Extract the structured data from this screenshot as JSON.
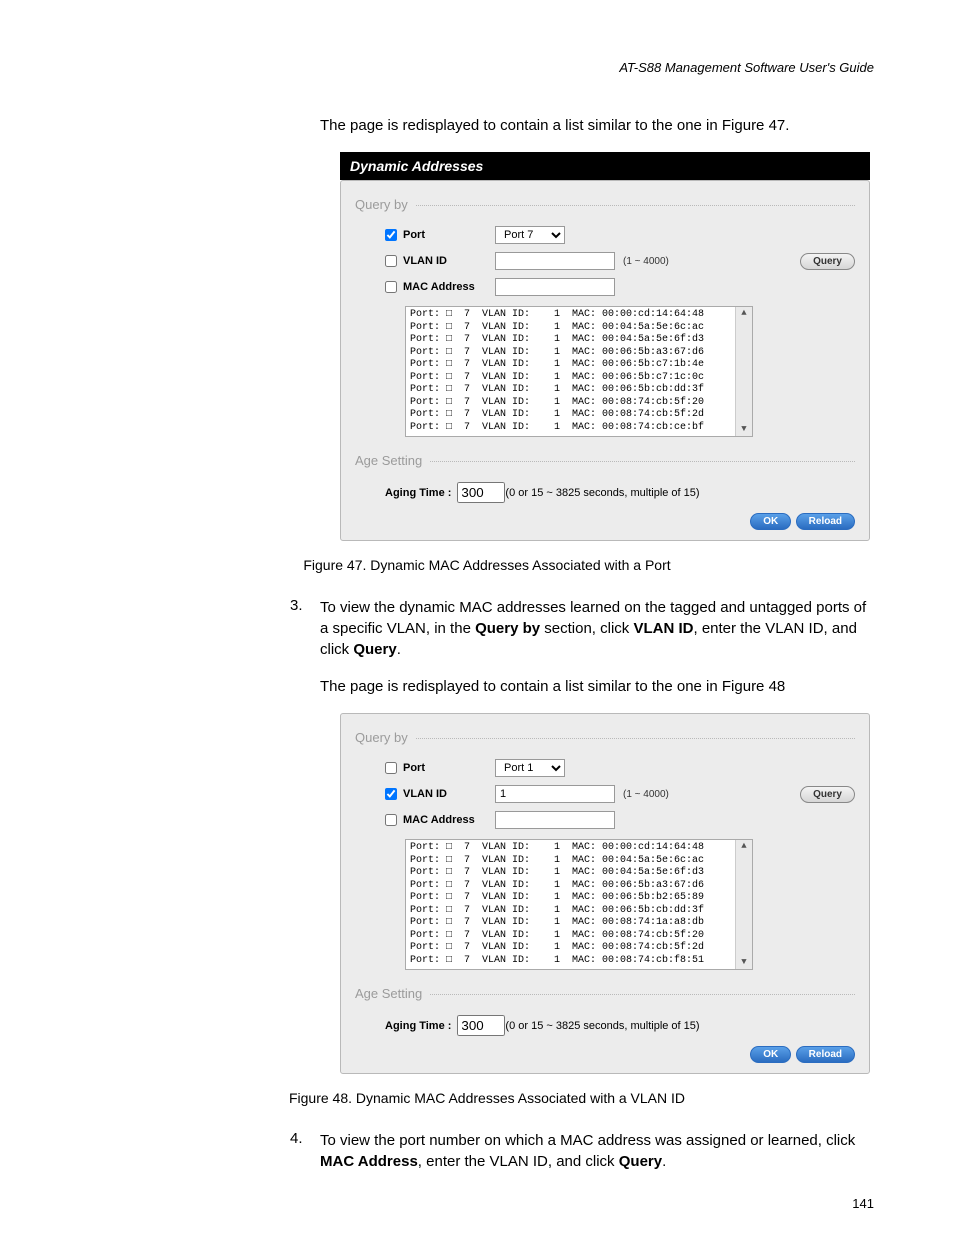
{
  "header": {
    "title": "AT-S88 Management Software User's Guide"
  },
  "intro1": "The page is redisplayed to contain a list similar to the one in Figure 47.",
  "fig47": {
    "header": "Dynamic Addresses",
    "query_section": "Query by",
    "age_section": "Age Setting",
    "port_label": "Port",
    "port_checked": true,
    "port_select": "Port 7",
    "vlan_label": "VLAN ID",
    "vlan_checked": false,
    "vlan_value": "",
    "vlan_range": "(1 ~ 4000)",
    "mac_label": "MAC Address",
    "mac_checked": false,
    "mac_value": "",
    "query_btn": "Query",
    "lines": "Port: □  7  VLAN ID:    1  MAC: 00:00:cd:14:64:48\nPort: □  7  VLAN ID:    1  MAC: 00:04:5a:5e:6c:ac\nPort: □  7  VLAN ID:    1  MAC: 00:04:5a:5e:6f:d3\nPort: □  7  VLAN ID:    1  MAC: 00:06:5b:a3:67:d6\nPort: □  7  VLAN ID:    1  MAC: 00:06:5b:c7:1b:4e\nPort: □  7  VLAN ID:    1  MAC: 00:06:5b:c7:1c:0c\nPort: □  7  VLAN ID:    1  MAC: 00:06:5b:cb:dd:3f\nPort: □  7  VLAN ID:    1  MAC: 00:08:74:cb:5f:20\nPort: □  7  VLAN ID:    1  MAC: 00:08:74:cb:5f:2d\nPort: □  7  VLAN ID:    1  MAC: 00:08:74:cb:ce:bf",
    "aging_label": "Aging Time :",
    "aging_value": "300",
    "aging_range": "(0 or 15 ~ 3825 seconds, multiple of 15)",
    "ok_btn": "OK",
    "reload_btn": "Reload",
    "caption": "Figure 47. Dynamic MAC Addresses Associated with a Port"
  },
  "step3": {
    "num": "3.",
    "text_parts": [
      "To view the dynamic MAC addresses learned on the tagged and untagged ports of a specific VLAN, in the ",
      "Query by",
      " section, click ",
      "VLAN ID",
      ", enter the VLAN ID, and click ",
      "Query",
      "."
    ]
  },
  "intro2": "The page is redisplayed to contain a list similar to the one in Figure 48",
  "fig48": {
    "query_section": "Query by",
    "age_section": "Age Setting",
    "port_label": "Port",
    "port_checked": false,
    "port_select": "Port 1",
    "vlan_label": "VLAN ID",
    "vlan_checked": true,
    "vlan_value": "1",
    "vlan_range": "(1 ~ 4000)",
    "mac_label": "MAC Address",
    "mac_checked": false,
    "mac_value": "",
    "query_btn": "Query",
    "lines": "Port: □  7  VLAN ID:    1  MAC: 00:00:cd:14:64:48\nPort: □  7  VLAN ID:    1  MAC: 00:04:5a:5e:6c:ac\nPort: □  7  VLAN ID:    1  MAC: 00:04:5a:5e:6f:d3\nPort: □  7  VLAN ID:    1  MAC: 00:06:5b:a3:67:d6\nPort: □  7  VLAN ID:    1  MAC: 00:06:5b:b2:65:89\nPort: □  7  VLAN ID:    1  MAC: 00:06:5b:cb:dd:3f\nPort: □  7  VLAN ID:    1  MAC: 00:08:74:1a:a8:db\nPort: □  7  VLAN ID:    1  MAC: 00:08:74:cb:5f:20\nPort: □  7  VLAN ID:    1  MAC: 00:08:74:cb:5f:2d\nPort: □  7  VLAN ID:    1  MAC: 00:08:74:cb:f8:51",
    "aging_label": "Aging Time :",
    "aging_value": "300",
    "aging_range": "(0 or 15 ~ 3825 seconds, multiple of 15)",
    "ok_btn": "OK",
    "reload_btn": "Reload",
    "caption": "Figure 48. Dynamic MAC Addresses Associated with a VLAN ID"
  },
  "step4": {
    "num": "4.",
    "text_parts": [
      "To view the port number on which a MAC address was assigned or learned, click ",
      "MAC Address",
      ", enter the VLAN ID, and click ",
      "Query",
      "."
    ]
  },
  "page_number": "141"
}
